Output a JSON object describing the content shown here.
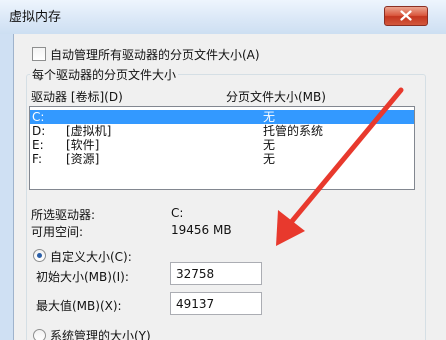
{
  "window": {
    "title": "虚拟内存"
  },
  "auto_manage": {
    "label": "自动管理所有驱动器的分页文件大小(A)",
    "checked": false
  },
  "group": {
    "legend": "每个驱动器的分页文件大小"
  },
  "list": {
    "headers": {
      "drive": "驱动器 [卷标](D)",
      "size": "分页文件大小(MB)"
    },
    "rows": [
      {
        "drive": "C:",
        "label": "",
        "size": "无",
        "selected": true
      },
      {
        "drive": "D:",
        "label": "[虚拟机]",
        "size": "托管的系统",
        "selected": false
      },
      {
        "drive": "E:",
        "label": "[软件]",
        "size": "无",
        "selected": false
      },
      {
        "drive": "F:",
        "label": "[资源]",
        "size": "无",
        "selected": false
      }
    ]
  },
  "selected_drive": {
    "drive_label": "所选驱动器:",
    "drive_value": "C:",
    "space_label": "可用空间:",
    "space_value": "19456 MB"
  },
  "custom_size": {
    "label": "自定义大小(C):",
    "selected": true,
    "initial_label": "初始大小(MB)(I):",
    "initial_value": "32758",
    "max_label": "最大值(MB)(X):",
    "max_value": "49137"
  },
  "system_managed": {
    "label": "系统管理的大小(Y)",
    "selected": false
  },
  "colors": {
    "selection": "#3399ff",
    "arrow": "#e8392d",
    "close": "#c4351f"
  },
  "icons": {
    "close": "close-icon"
  }
}
